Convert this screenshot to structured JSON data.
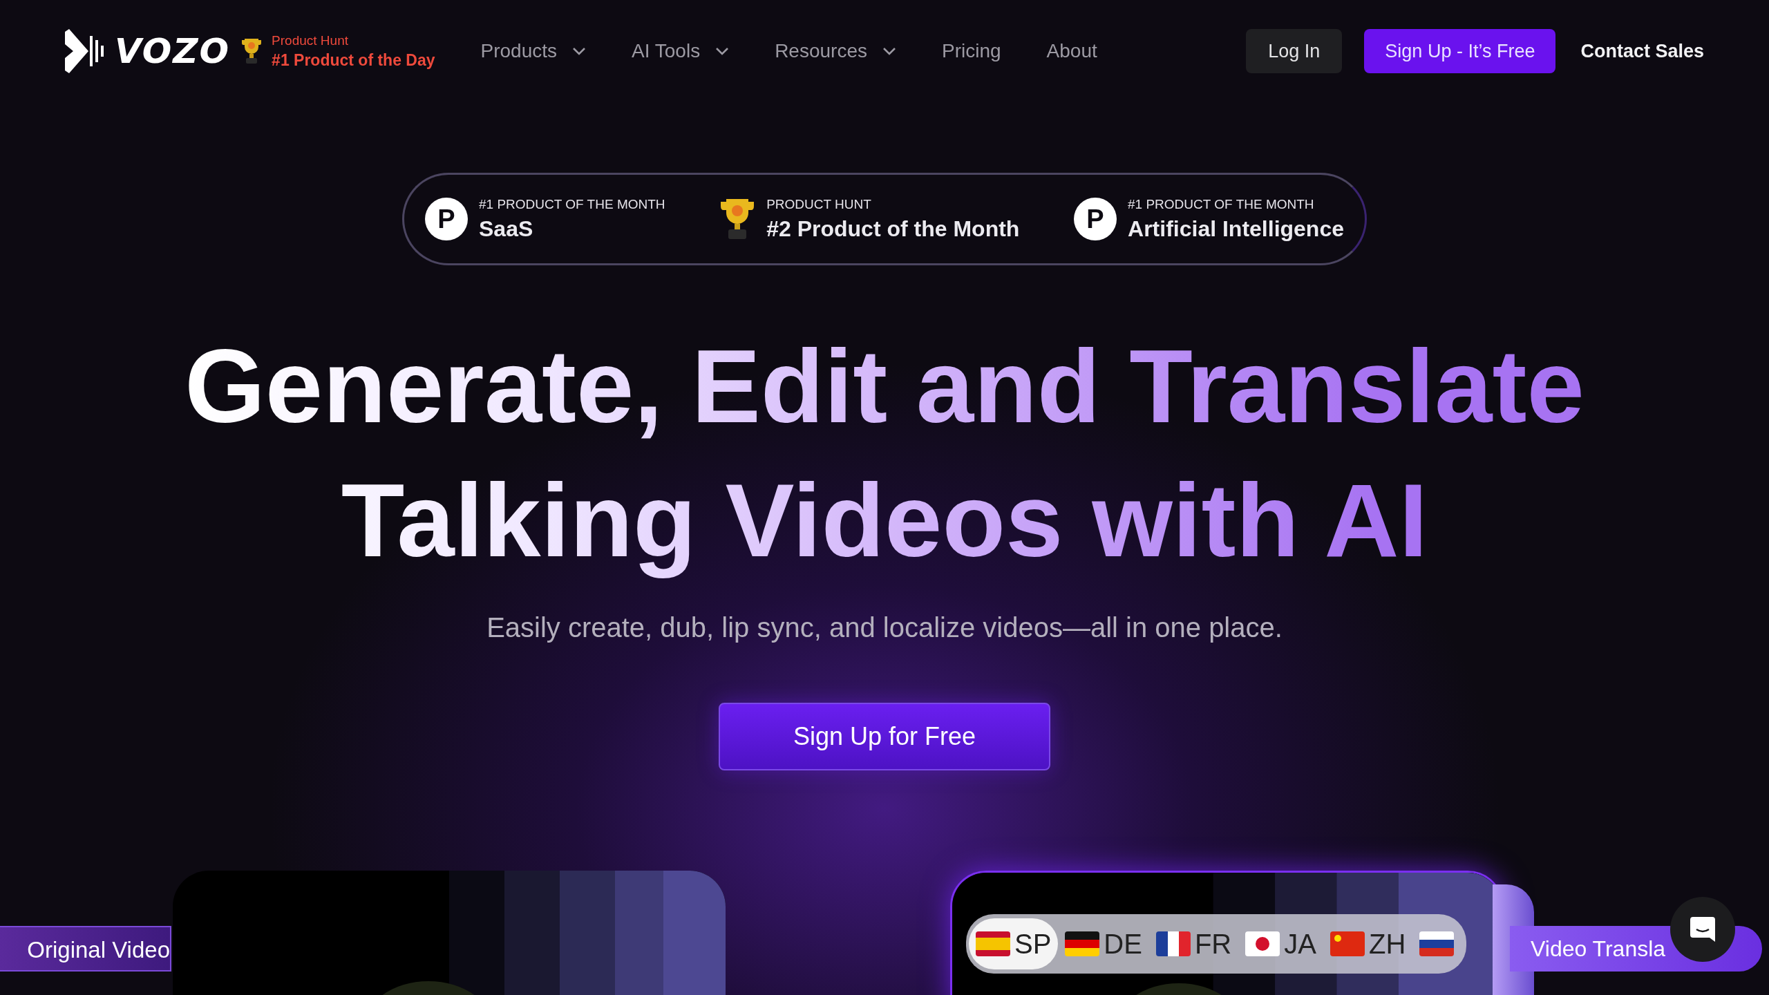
{
  "header": {
    "logo": "VOZO",
    "award": {
      "source": "Product Hunt",
      "title": "#1 Product of the Day"
    },
    "nav": [
      {
        "label": "Products",
        "dropdown": true
      },
      {
        "label": "AI Tools",
        "dropdown": true
      },
      {
        "label": "Resources",
        "dropdown": true
      },
      {
        "label": "Pricing",
        "dropdown": false
      },
      {
        "label": "About",
        "dropdown": false
      }
    ],
    "login": "Log In",
    "signup": "Sign Up - It’s Free",
    "contact": "Contact Sales"
  },
  "badges": [
    {
      "kind": "logo",
      "letter": "P",
      "caption": "#1 PRODUCT OF THE MONTH",
      "title": "SaaS"
    },
    {
      "kind": "trophy",
      "caption": "PRODUCT HUNT",
      "title": "#2 Product of the Month"
    },
    {
      "kind": "logo",
      "letter": "P",
      "caption": "#1 PRODUCT OF THE MONTH",
      "title": "Artificial Intelligence"
    }
  ],
  "hero": {
    "title_lines": [
      "Generate, Edit and Translate",
      "Talking Videos with AI"
    ],
    "subtitle": "Easily create, dub, lip sync, and localize videos—all in one place.",
    "cta": "Sign Up for Free"
  },
  "demo": {
    "original_label": "Original Video",
    "translated_label": "Video Transla",
    "languages": [
      {
        "label": "SP",
        "selected": true
      },
      {
        "label": "DE",
        "selected": false
      },
      {
        "label": "FR",
        "selected": false
      },
      {
        "label": "JA",
        "selected": false
      },
      {
        "label": "ZH",
        "selected": false
      },
      {
        "selected": false
      }
    ]
  }
}
